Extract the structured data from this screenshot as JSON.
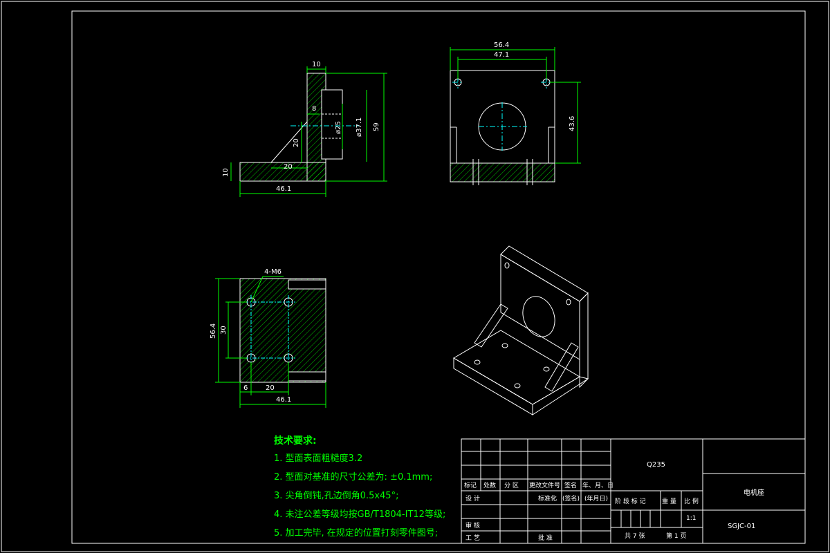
{
  "drawing": {
    "dimensions": {
      "top_flange_width": "10",
      "slot_width": "8",
      "chamfer_v": "20",
      "chamfer_h": "20",
      "base_thickness": "10",
      "front_width": "46.1",
      "bore_small": "ø25",
      "bore_large": "ø37.1",
      "total_height": "59",
      "overall_width": "56.4",
      "hole_pitch": "47.1",
      "center_height": "43.6",
      "thread_callout": "4-M6",
      "plan_height": "56.4",
      "plan_pitch": "30",
      "plan_edge": "6",
      "plan_spacing": "20",
      "plan_width": "46.1"
    },
    "notes": {
      "title": "技术要求:",
      "items": [
        "1. 型面表面粗糙度3.2",
        "2. 型面对基准的尺寸公差为: ±0.1mm;",
        "3. 尖角倒钝,孔边倒角0.5x45°;",
        "4. 未注公差等级均按GB/T1804-IT12等级;",
        "5. 加工完毕, 在规定的位置打刻零件图号;"
      ]
    },
    "title_block": {
      "material": "Q235",
      "part_name": "电机座",
      "drawing_number": "SGJC-01",
      "scale": "1:1",
      "sheets": "共 7 张",
      "sheet": "第 1 页",
      "rev_headers": [
        "标记",
        "处数",
        "分 区",
        "更改文件号",
        "签名",
        "年、月、日"
      ],
      "sign_row": [
        "设 计",
        "标准化",
        "(签名)",
        "(年月日)"
      ],
      "stage_headers": [
        "阶 段 标 记",
        "重 量",
        "比 例"
      ],
      "review": "审 核",
      "process": "工 艺",
      "approve": "批 准"
    }
  }
}
